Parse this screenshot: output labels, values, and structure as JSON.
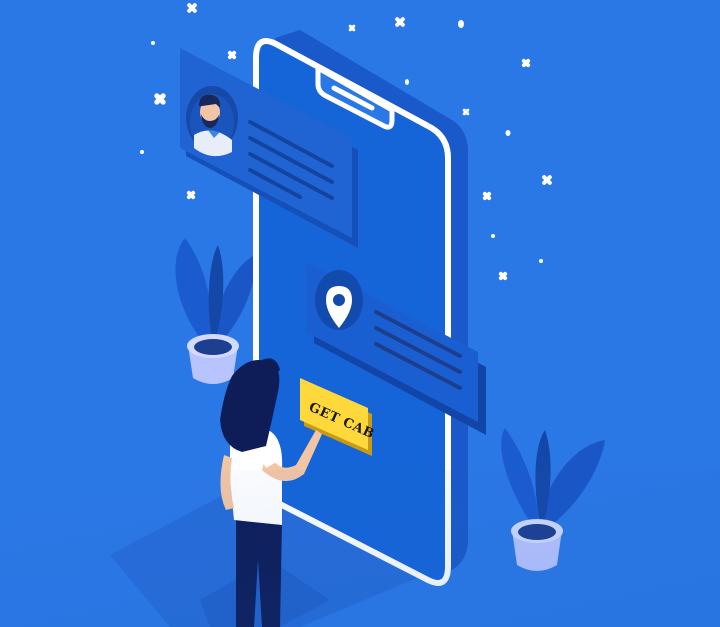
{
  "scene": {
    "background": "#2a78e6",
    "accent_yellow": "#ffd93b",
    "phone_color": "#1565d8",
    "phone_outline": "#ffffff"
  },
  "cta": {
    "label": "GET CAB"
  },
  "icons": {
    "profile": "user-avatar-icon",
    "location": "map-pin-icon"
  }
}
